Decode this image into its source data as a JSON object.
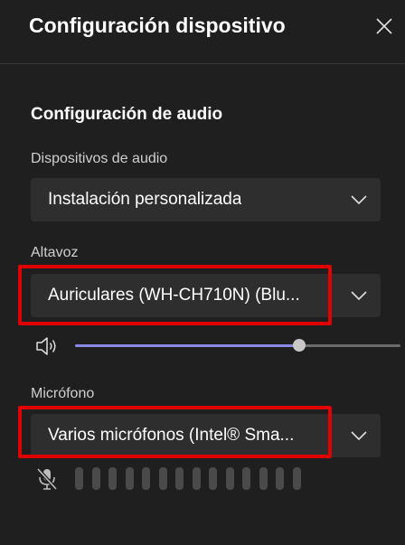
{
  "header": {
    "title": "Configuración dispositivo",
    "close_icon": "close-icon"
  },
  "audio": {
    "section_title": "Configuración de audio",
    "devices_label": "Dispositivos de audio",
    "devices_value": "Instalación personalizada",
    "speaker_label": "Altavoz",
    "speaker_value": "Auriculares (WH-CH710N) (Blu...",
    "speaker_volume": 0.69,
    "mic_label": "Micrófono",
    "mic_value": "Varios micrófonos (Intel® Sma...",
    "mic_level_bar_count": 14,
    "mic_level_active": 0
  },
  "icons": {
    "chevron": "chevron-down-icon",
    "volume": "speaker-icon",
    "mic_muted": "mic-muted-icon"
  },
  "colors": {
    "background": "#1f1f1f",
    "select_bg": "#2e2e2e",
    "highlight": "#e00000",
    "slider_fill": "#8a8ae6",
    "slider_thumb": "#c8c8c8",
    "level_bar": "#4a4a4a"
  }
}
